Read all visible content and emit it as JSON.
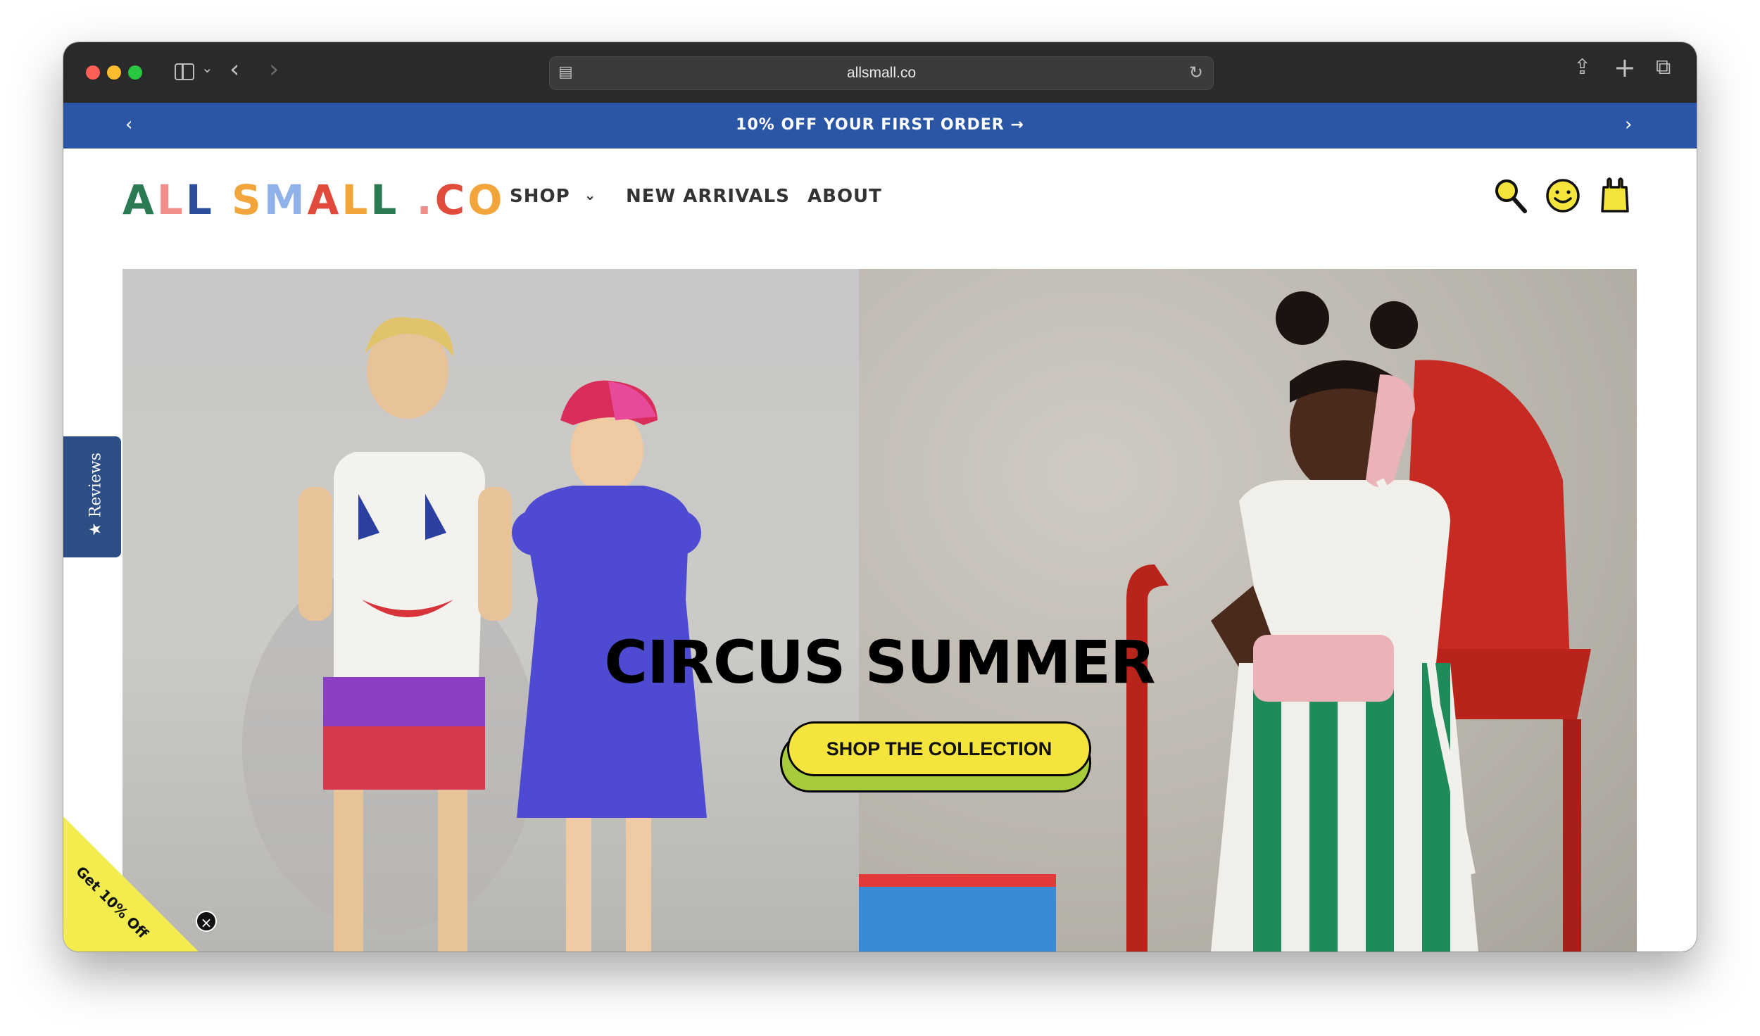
{
  "browser": {
    "url": "allsmall.co"
  },
  "announcement": {
    "text": "10% OFF YOUR FIRST ORDER →"
  },
  "logo": {
    "letters": [
      {
        "char": "A",
        "color": "#2a7a52"
      },
      {
        "char": "L",
        "color": "#f08e8a"
      },
      {
        "char": "L",
        "color": "#2b4e9a"
      },
      {
        "char": " ",
        "color": "#000000"
      },
      {
        "char": "S",
        "color": "#f1a53a"
      },
      {
        "char": "M",
        "color": "#8fb2e8"
      },
      {
        "char": "A",
        "color": "#e04b3c"
      },
      {
        "char": "L",
        "color": "#f1a53a"
      },
      {
        "char": "L",
        "color": "#2a7a52"
      },
      {
        "char": " ",
        "color": "#000000"
      },
      {
        "char": ".",
        "color": "#f08e8a"
      },
      {
        "char": "C",
        "color": "#e04b3c"
      },
      {
        "char": "O",
        "color": "#f1a53a"
      }
    ]
  },
  "nav": {
    "shop": "SHOP",
    "new_arrivals": "NEW ARRIVALS",
    "about": "ABOUT"
  },
  "hero": {
    "title": "CIRCUS SUMMER",
    "cta": "SHOP THE COLLECTION"
  },
  "widgets": {
    "reviews": "★ Reviews",
    "promo": "Get 10% Off"
  },
  "icons": {
    "search": "search-icon",
    "account": "smiley-icon",
    "cart": "bag-icon"
  },
  "colors": {
    "announcement_bg": "#2b56a6",
    "cta_bg": "#f5e43b",
    "cta_shadow": "#a6cc3c",
    "reviews_bg": "#2d4d85",
    "promo_bg": "#f2ec4f"
  }
}
